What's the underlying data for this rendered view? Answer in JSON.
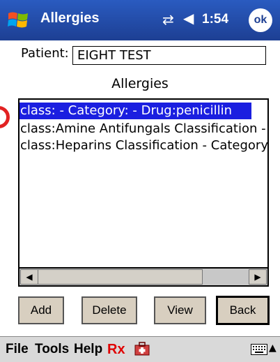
{
  "titlebar": {
    "title": "Allergies",
    "clock": "1:54",
    "ok_label": "ok",
    "color": "#1d3f93"
  },
  "patient": {
    "label": "Patient:",
    "value": "EIGHT TEST"
  },
  "section_title": "Allergies",
  "allergies_list": {
    "items": [
      {
        "text": "class: - Category: - Drug:penicillin",
        "selected": true
      },
      {
        "text": "class:Amine Antifungals Classification - Category:",
        "selected": false
      },
      {
        "text": "class:Heparins Classification - Category:",
        "selected": false
      }
    ],
    "selected_color": "#1b1fe0"
  },
  "buttons": {
    "add": "Add",
    "delete": "Delete",
    "view": "View",
    "back": "Back"
  },
  "menubar": {
    "file": "File",
    "tools": "Tools",
    "help": "Help",
    "rx": "Rx"
  },
  "icons": [
    "windows-start-icon",
    "connectivity-icon",
    "volume-icon",
    "rx-kit-icon",
    "keyboard-icon",
    "input-panel-arrow-icon"
  ]
}
